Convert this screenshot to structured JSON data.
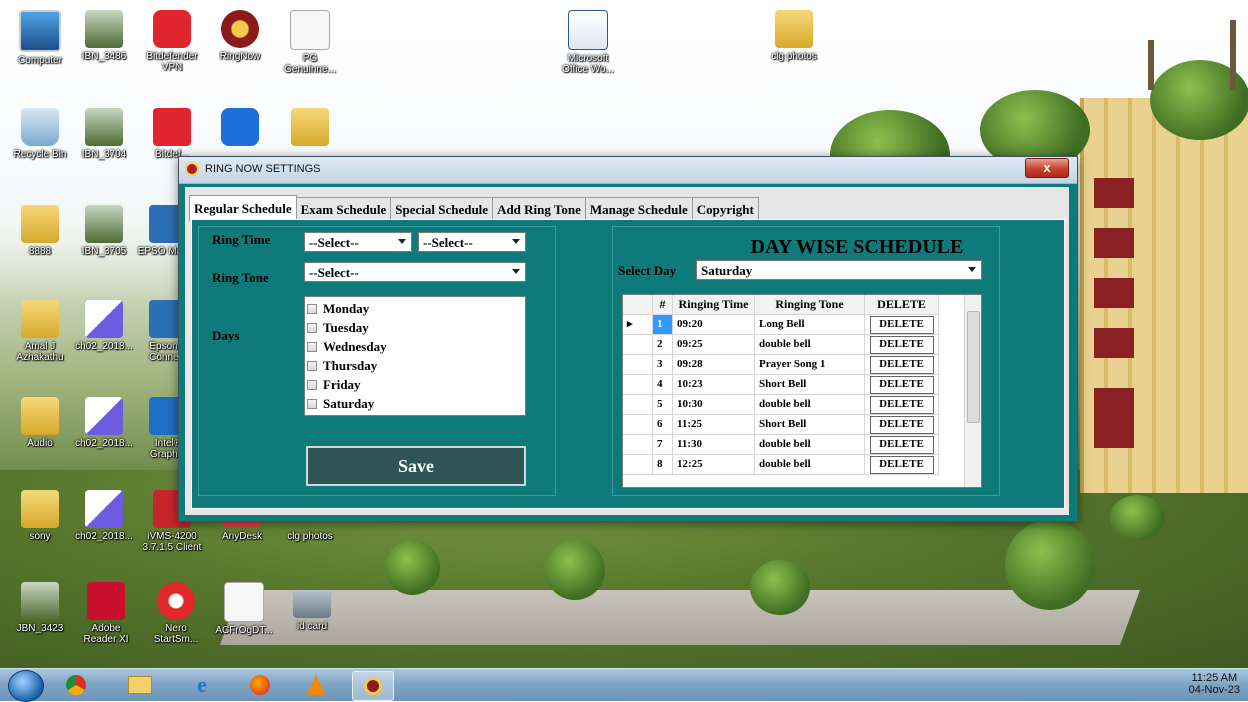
{
  "desktop": {
    "icons": [
      {
        "label": "Computer"
      },
      {
        "label": "IBN_3486"
      },
      {
        "label": "Bitdefender VPN"
      },
      {
        "label": "RingNow"
      },
      {
        "label": "PG Genuinne..."
      },
      {
        "label": "Microsoft Office Wo..."
      },
      {
        "label": "clg photos"
      },
      {
        "label": "Recycle Bin"
      },
      {
        "label": "IBN_3704"
      },
      {
        "label": "Bitdef..."
      },
      {
        "label": "8888"
      },
      {
        "label": "IBN_3705"
      },
      {
        "label": "EPSO Mani..."
      },
      {
        "label": "Amal J Azhakathu"
      },
      {
        "label": "ch02_2018..."
      },
      {
        "label": "Epson F Conne..."
      },
      {
        "label": "Audio"
      },
      {
        "label": "ch02_2018..."
      },
      {
        "label": "Intel® Graph..."
      },
      {
        "label": "sony"
      },
      {
        "label": "ch02_2018..."
      },
      {
        "label": "iVMS-4200 3.7.1.5 Client"
      },
      {
        "label": "AnyDesk"
      },
      {
        "label": "clg photos"
      },
      {
        "label": "JBN_3423"
      },
      {
        "label": "Adobe Reader XI"
      },
      {
        "label": "Nero StartSm..."
      },
      {
        "label": "ACFrOgDT..."
      },
      {
        "label": "id card"
      }
    ]
  },
  "window": {
    "title": "RING NOW SETTINGS",
    "close_label": "x"
  },
  "tabs": [
    "Regular Schedule",
    "Exam Schedule",
    "Special Schedule",
    "Add Ring Tone",
    "Manage Schedule",
    "Copyright"
  ],
  "regular": {
    "ring_time_label": "Ring Time",
    "ring_time_hour": "--Select--",
    "ring_time_minute": "--Select--",
    "ring_tone_label": "Ring Tone",
    "ring_tone_value": "--Select--",
    "days_label": "Days",
    "days": [
      "Monday",
      "Tuesday",
      "Wednesday",
      "Thursday",
      "Friday",
      "Saturday"
    ],
    "save_label": "Save"
  },
  "daywise": {
    "title": "DAY WISE SCHEDULE",
    "select_day_label": "Select Day",
    "selected_day": "Saturday",
    "columns": [
      "#",
      "Ringing Time",
      "Ringing Tone",
      "DELETE"
    ],
    "rows": [
      {
        "n": "1",
        "time": "09:20",
        "tone": "Long Bell",
        "del": "DELETE"
      },
      {
        "n": "2",
        "time": "09:25",
        "tone": "double bell",
        "del": "DELETE"
      },
      {
        "n": "3",
        "time": "09:28",
        "tone": "Prayer Song 1",
        "del": "DELETE"
      },
      {
        "n": "4",
        "time": "10:23",
        "tone": "Short Bell",
        "del": "DELETE"
      },
      {
        "n": "5",
        "time": "10:30",
        "tone": "double bell",
        "del": "DELETE"
      },
      {
        "n": "6",
        "time": "11:25",
        "tone": "Short Bell",
        "del": "DELETE"
      },
      {
        "n": "7",
        "time": "11:30",
        "tone": "double bell",
        "del": "DELETE"
      },
      {
        "n": "8",
        "time": "12:25",
        "tone": "double bell",
        "del": "DELETE"
      }
    ]
  },
  "taskbar": {
    "time": "11:25 AM",
    "date": "04-Nov-23"
  }
}
